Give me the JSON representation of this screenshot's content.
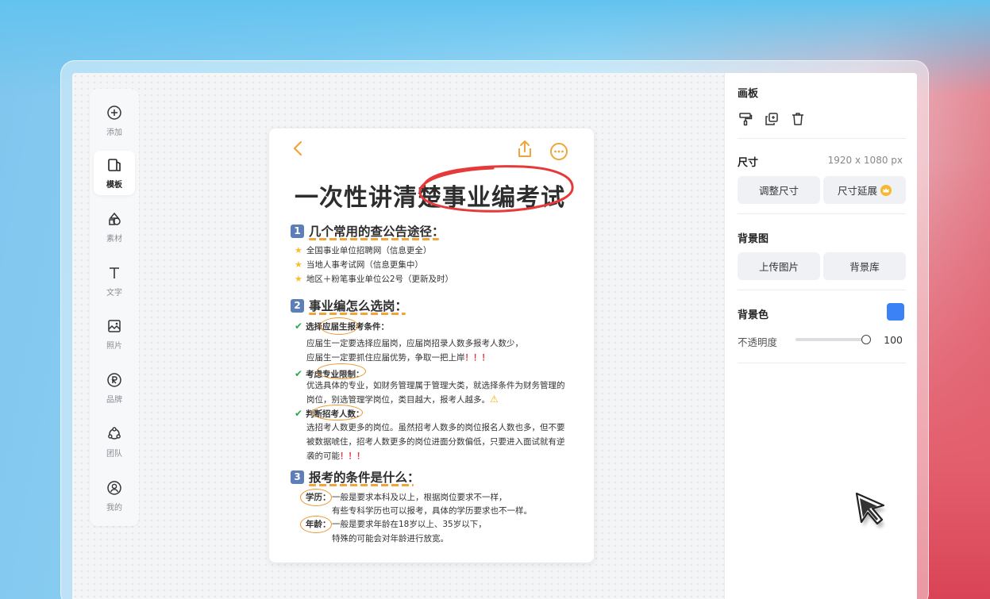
{
  "toolbar": {
    "items": [
      {
        "label": "添加",
        "icon": "plus-circle-icon"
      },
      {
        "label": "模板",
        "icon": "template-icon",
        "active": true
      },
      {
        "label": "素材",
        "icon": "shapes-icon"
      },
      {
        "label": "文字",
        "icon": "text-icon"
      },
      {
        "label": "照片",
        "icon": "image-icon"
      },
      {
        "label": "品牌",
        "icon": "registered-icon"
      },
      {
        "label": "团队",
        "icon": "team-icon"
      },
      {
        "label": "我的",
        "icon": "user-icon"
      }
    ]
  },
  "card": {
    "title": "一次性讲清楚事业编考试",
    "s1": {
      "num": "1",
      "heading": "几个常用的查公告途径：",
      "items": [
        "全国事业单位招聘网（信息更全）",
        "当地人事考试网（信息更集中）",
        "地区＋粉笔事业单位公2号（更新及时）"
      ]
    },
    "s2": {
      "num": "2",
      "heading": "事业编怎么选岗：",
      "a_title": "选择应届生报考条件：",
      "a_line1": "应届生一定要选择应届岗，应届岗招录人数多报考人数少，",
      "a_line2": "应届生一定要抓住应届优势，争取一把上岸",
      "a_mark": "！！！",
      "b_title": "考虑专业限制：",
      "b_line1": "优选具体的专业，如财务管理属于管理大类，就选择条件为财务管理的",
      "b_line2": "岗位，别选管理学岗位，类目越大，报考人越多。",
      "b_warn": "⚠",
      "c_title": "判断招考人数：",
      "c_line1": "选招考人数更多的岗位。虽然招考人数多的岗位报名人数也多，但不要",
      "c_line2": "被数据唬住，招考人数更多的岗位进面分数偏低，只要进入面试就有逆",
      "c_line3": "袭的可能",
      "c_mark": "！！！"
    },
    "s3": {
      "num": "3",
      "heading": "报考的条件是什么：",
      "edu_label": "学历：",
      "edu_line1": "一般是要求本科及以上，根据岗位要求不一样，",
      "edu_line2": "有些专科学历也可以报考，具体的学历要求也不一样。",
      "age_label": "年龄：",
      "age_line1": "一般是要求年龄在18岁以上、35岁以下，",
      "age_line2": "特殊的可能会对年龄进行放宽。"
    }
  },
  "panel": {
    "section": "画板",
    "size_label": "尺寸",
    "size_value": "1920 x 1080 px",
    "resize_button": "调整尺寸",
    "extend_button": "尺寸延展",
    "bg_image_label": "背景图",
    "upload_button": "上传图片",
    "library_button": "背景库",
    "bg_color_label": "背景色",
    "bg_color": "#3b82f6",
    "opacity_label": "不透明度",
    "opacity_value": "100"
  }
}
